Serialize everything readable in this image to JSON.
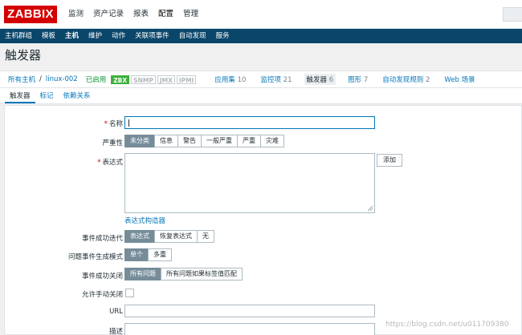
{
  "header": {
    "logo": "ZABBIX",
    "nav": [
      "监测",
      "资产记录",
      "报表",
      "配置",
      "管理"
    ],
    "active_nav": "配置"
  },
  "subnav": {
    "items": [
      "主机群组",
      "模板",
      "主机",
      "维护",
      "动作",
      "关联项事件",
      "自动发现",
      "服务"
    ],
    "active": "主机"
  },
  "page": {
    "title": "触发器"
  },
  "host_nav": {
    "all_hosts": "所有主机",
    "separator": "/",
    "host": "linux-002",
    "status": "已启用",
    "availability": [
      "ZBX",
      "SNMP",
      "JMX",
      "IPMI"
    ],
    "links": [
      {
        "label": "应用集",
        "count": "10"
      },
      {
        "label": "监控项",
        "count": "21"
      },
      {
        "label": "触发器",
        "count": "6"
      },
      {
        "label": "图形",
        "count": "7"
      },
      {
        "label": "自动发现规则",
        "count": "2"
      },
      {
        "label": "Web 场景",
        "count": ""
      }
    ]
  },
  "tabs": [
    "触发器",
    "标记",
    "依赖关系"
  ],
  "form": {
    "name_label": "名称",
    "name_value": "",
    "severity_label": "严重性",
    "severity_options": [
      "未分类",
      "信息",
      "警告",
      "一般严重",
      "严重",
      "灾难"
    ],
    "severity_selected": "未分类",
    "expression_label": "表达式",
    "expression_value": "",
    "add_button": "添加",
    "expression_builder_link": "表达式构造器",
    "ok_event_label": "事件成功迭代",
    "ok_event_options": [
      "表达式",
      "恢复表达式",
      "无"
    ],
    "ok_event_selected": "表达式",
    "problem_mode_label": "问题事件生成模式",
    "problem_mode_options": [
      "单个",
      "多重"
    ],
    "problem_mode_selected": "单个",
    "ok_close_label": "事件成功关闭",
    "ok_close_options": [
      "所有问题",
      "所有问题如果标签值匹配"
    ],
    "ok_close_selected": "所有问题",
    "manual_close_label": "允许手动关闭",
    "url_label": "URL",
    "url_value": "",
    "description_label": "描述"
  },
  "watermark": "https://blog.csdn.net/u011709380",
  "colors": {
    "logo_bg": "#d40000",
    "subnav_bg": "#0a466a",
    "link": "#0275b8",
    "selected_segment": "#768d99",
    "status_green": "#0b9433",
    "zbx_green": "#3bb03b"
  }
}
